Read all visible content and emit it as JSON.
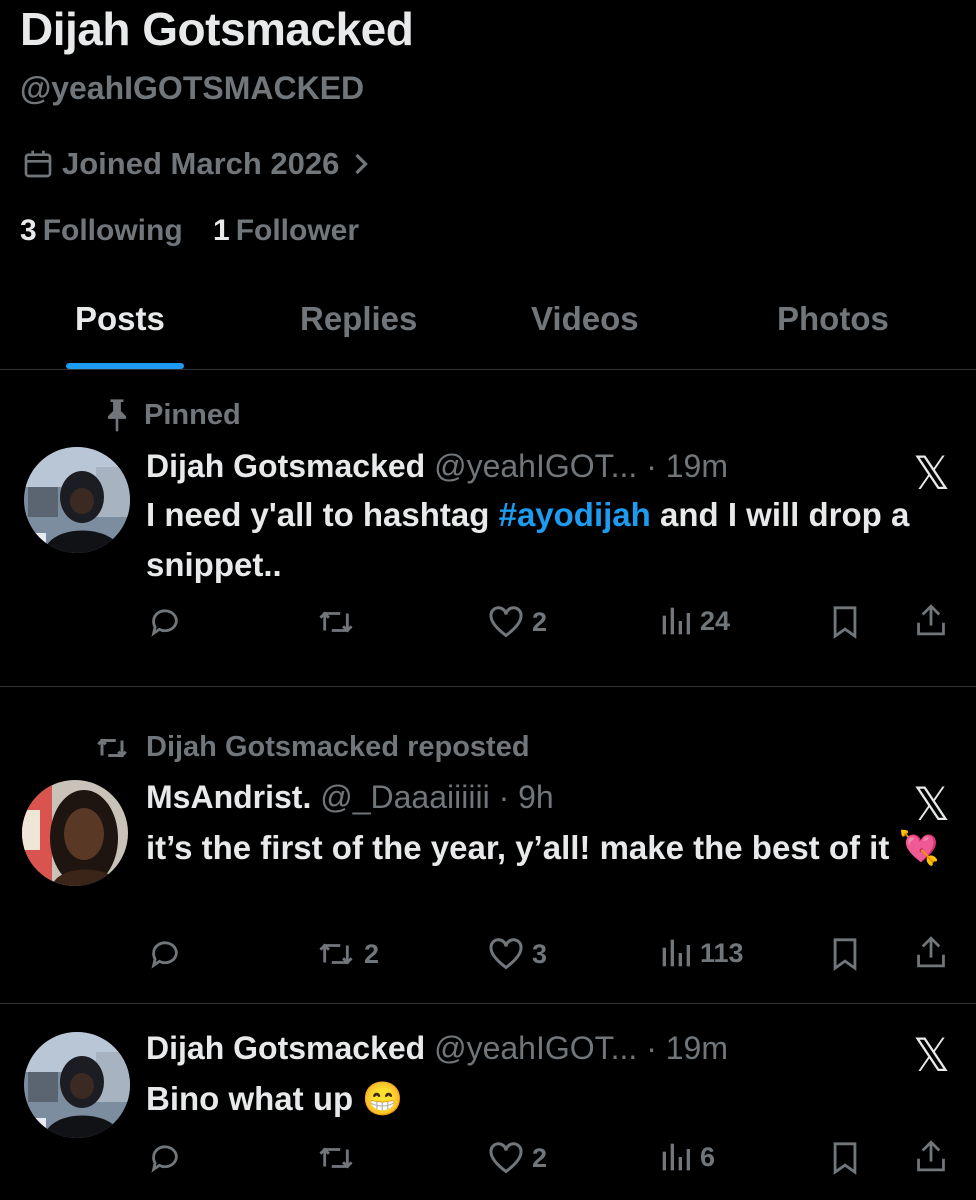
{
  "profile": {
    "name": "Dijah Gotsmacked",
    "handle": "@yeahIGOTSMACKED",
    "joined": "Joined March 2026",
    "following_count": "3",
    "following_label": "Following",
    "followers_count": "1",
    "followers_label": "Follower"
  },
  "tabs": [
    {
      "label": "Posts",
      "active": true
    },
    {
      "label": "Replies",
      "active": false
    },
    {
      "label": "Videos",
      "active": false
    },
    {
      "label": "Photos",
      "active": false
    }
  ],
  "posts": [
    {
      "context": "Pinned",
      "context_icon": "pin-icon",
      "author": "Dijah Gotsmacked",
      "handle": "@yeahIGOT...",
      "time": "· 19m",
      "text_before": "I need y'all to hashtag ",
      "hashtag": "#ayodijah",
      "text_after": " and I will drop a snippet..",
      "replies": "",
      "reposts": "",
      "likes": "2",
      "views": "24"
    },
    {
      "context": "Dijah Gotsmacked reposted",
      "context_icon": "repost-icon",
      "author": "MsAndrist.",
      "handle": "@_Daaaiiiiii",
      "time": "· 9h",
      "text": "it’s the first of the year, y’all! make the best of it 💘",
      "replies": "",
      "reposts": "2",
      "likes": "3",
      "views": "113"
    },
    {
      "author": "Dijah Gotsmacked",
      "handle": "@yeahIGOT...",
      "time": "· 19m",
      "text": "Bino what up 😁",
      "replies": "",
      "reposts": "",
      "likes": "2",
      "views": "6"
    }
  ],
  "colors": {
    "background": "#000000",
    "text": "#e7e9ea",
    "muted": "#71767b",
    "accent": "#1d9bf0",
    "divider": "#2f3336"
  }
}
